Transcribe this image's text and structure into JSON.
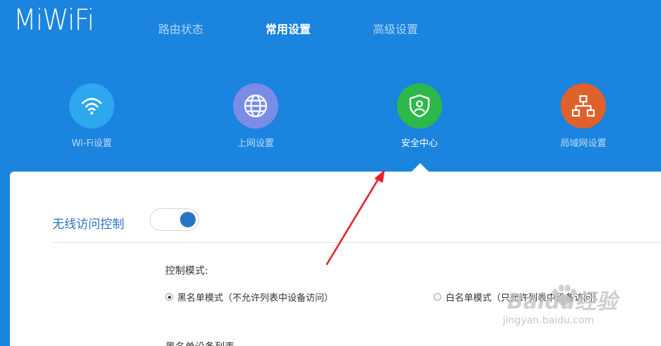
{
  "header": {
    "logo": "MiWiFi",
    "nav": [
      {
        "label": "路由状态",
        "active": false
      },
      {
        "label": "常用设置",
        "active": true
      },
      {
        "label": "高级设置",
        "active": false
      }
    ]
  },
  "menu": [
    {
      "label": "Wi-Fi设置",
      "icon": "wifi-icon",
      "color": "#2ea7ef",
      "active": false
    },
    {
      "label": "上网设置",
      "icon": "globe-icon",
      "color": "#7b8ce8",
      "active": false
    },
    {
      "label": "安全中心",
      "icon": "shield-user-icon",
      "color": "#2db84a",
      "active": true
    },
    {
      "label": "局域网设置",
      "icon": "network-icon",
      "color": "#e0612b",
      "active": false
    }
  ],
  "panel": {
    "section_title": "无线访问控制",
    "toggle_state": "on",
    "control_mode_label": "控制模式:",
    "options": [
      {
        "label": "黑名单模式（不允许列表中设备访问）",
        "checked": true
      },
      {
        "label": "白名单模式（只允许列表中设备访问）",
        "checked": false
      }
    ],
    "device_list_label": "黑名单设备列表"
  },
  "watermark": {
    "text": "Baidu经验",
    "url_text": "jingyan.baidu.com"
  },
  "colors": {
    "header_bg": "#1a84df",
    "accent": "#2b73c4",
    "annotation": "#e8202a"
  }
}
